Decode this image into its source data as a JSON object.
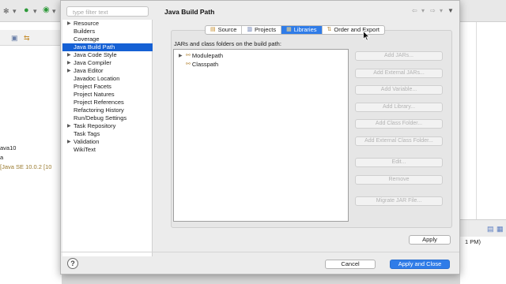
{
  "background": {
    "left_lines": [
      "ava10",
      "a",
      "[Java SE 10.0.2 [10"
    ],
    "right_lines": [
      "1 PM)"
    ]
  },
  "dialog": {
    "filter_placeholder": "type filter text",
    "title": "Java Build Path",
    "tree_items": [
      {
        "label": "Resource",
        "expandable": true,
        "selected": false
      },
      {
        "label": "Builders",
        "expandable": false,
        "selected": false
      },
      {
        "label": "Coverage",
        "expandable": false,
        "selected": false
      },
      {
        "label": "Java Build Path",
        "expandable": false,
        "selected": true
      },
      {
        "label": "Java Code Style",
        "expandable": true,
        "selected": false
      },
      {
        "label": "Java Compiler",
        "expandable": true,
        "selected": false
      },
      {
        "label": "Java Editor",
        "expandable": true,
        "selected": false
      },
      {
        "label": "Javadoc Location",
        "expandable": false,
        "selected": false
      },
      {
        "label": "Project Facets",
        "expandable": false,
        "selected": false
      },
      {
        "label": "Project Natures",
        "expandable": false,
        "selected": false
      },
      {
        "label": "Project References",
        "expandable": false,
        "selected": false
      },
      {
        "label": "Refactoring History",
        "expandable": false,
        "selected": false
      },
      {
        "label": "Run/Debug Settings",
        "expandable": false,
        "selected": false
      },
      {
        "label": "Task Repository",
        "expandable": true,
        "selected": false
      },
      {
        "label": "Task Tags",
        "expandable": false,
        "selected": false
      },
      {
        "label": "Validation",
        "expandable": true,
        "selected": false
      },
      {
        "label": "WikiText",
        "expandable": false,
        "selected": false
      }
    ],
    "tabs": [
      {
        "label": "Source",
        "icon": "source-folder-icon",
        "active": false
      },
      {
        "label": "Projects",
        "icon": "projects-icon",
        "active": false
      },
      {
        "label": "Libraries",
        "icon": "libraries-icon",
        "active": true
      },
      {
        "label": "Order and Export",
        "icon": "order-export-icon",
        "active": false
      }
    ],
    "jars_label": "JARs and class folders on the build path:",
    "build_path_entries": [
      "Modulepath",
      "Classpath"
    ],
    "side_buttons": [
      "Add JARs...",
      "Add External JARs...",
      "Add Variable...",
      "Add Library...",
      "Add Class Folder...",
      "Add External Class Folder...",
      "Edit...",
      "Remove",
      "Migrate JAR File..."
    ],
    "apply_label": "Apply",
    "cancel_label": "Cancel",
    "apply_close_label": "Apply and Close",
    "help_symbol": "?"
  },
  "colors": {
    "selection": "#1560d4",
    "accent": "#2f7ce8"
  }
}
